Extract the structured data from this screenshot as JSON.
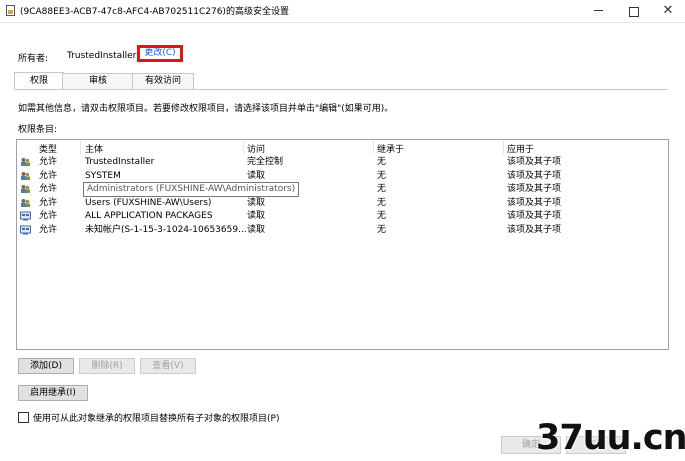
{
  "window": {
    "title": "(9CA88EE3-ACB7-47c8-AFC4-AB702511C276)的高级安全设置"
  },
  "owner": {
    "label": "所有者:",
    "value": "TrustedInstaller",
    "change_link": "更改(C)"
  },
  "tabs": [
    {
      "label": "权限"
    },
    {
      "label": "审核"
    },
    {
      "label": "有效访问"
    }
  ],
  "info_text": "如需其他信息，请双击权限项目。若要修改权限项目，请选择该项目并单击\"编辑\"(如果可用)。",
  "entries_label": "权限条目:",
  "table": {
    "headers": [
      "类型",
      "主体",
      "访问",
      "继承于",
      "应用于"
    ],
    "rows": [
      {
        "icon": "user-group-icon",
        "type": "允许",
        "principal": "TrustedInstaller",
        "access": "完全控制",
        "inherited": "无",
        "applies": "该项及其子项"
      },
      {
        "icon": "user-group-icon",
        "type": "允许",
        "principal": "SYSTEM",
        "access": "读取",
        "inherited": "无",
        "applies": "该项及其子项"
      },
      {
        "icon": "user-group-icon",
        "type": "允许",
        "principal": "",
        "access": "",
        "inherited": "无",
        "applies": "该项及其子项"
      },
      {
        "icon": "user-group-icon",
        "type": "允许",
        "principal": "Users (FUXSHINE-AW\\Users)",
        "access": "读取",
        "inherited": "无",
        "applies": "该项及其子项"
      },
      {
        "icon": "package-icon",
        "type": "允许",
        "principal": "ALL APPLICATION PACKAGES",
        "access": "读取",
        "inherited": "无",
        "applies": "该项及其子项"
      },
      {
        "icon": "package-icon",
        "type": "允许",
        "principal": "未知帐户(S-1-15-3-1024-10653659...",
        "access": "读取",
        "inherited": "无",
        "applies": "该项及其子项"
      }
    ],
    "tooltip": "Administrators (FUXSHINE-AW\\Administrators)"
  },
  "buttons": {
    "add": "添加(D)",
    "remove": "删除(R)",
    "view": "查看(V)",
    "enable_inheritance": "启用继承(I)",
    "replace_checkbox": "使用可从此对象继承的权限项目替换所有子对象的权限项目(P)",
    "ok": "确定",
    "cancel": "取消"
  },
  "watermark": "37uu.cn",
  "colors": {
    "highlight_box": "#e8111b",
    "link": "#1a5fd1"
  }
}
